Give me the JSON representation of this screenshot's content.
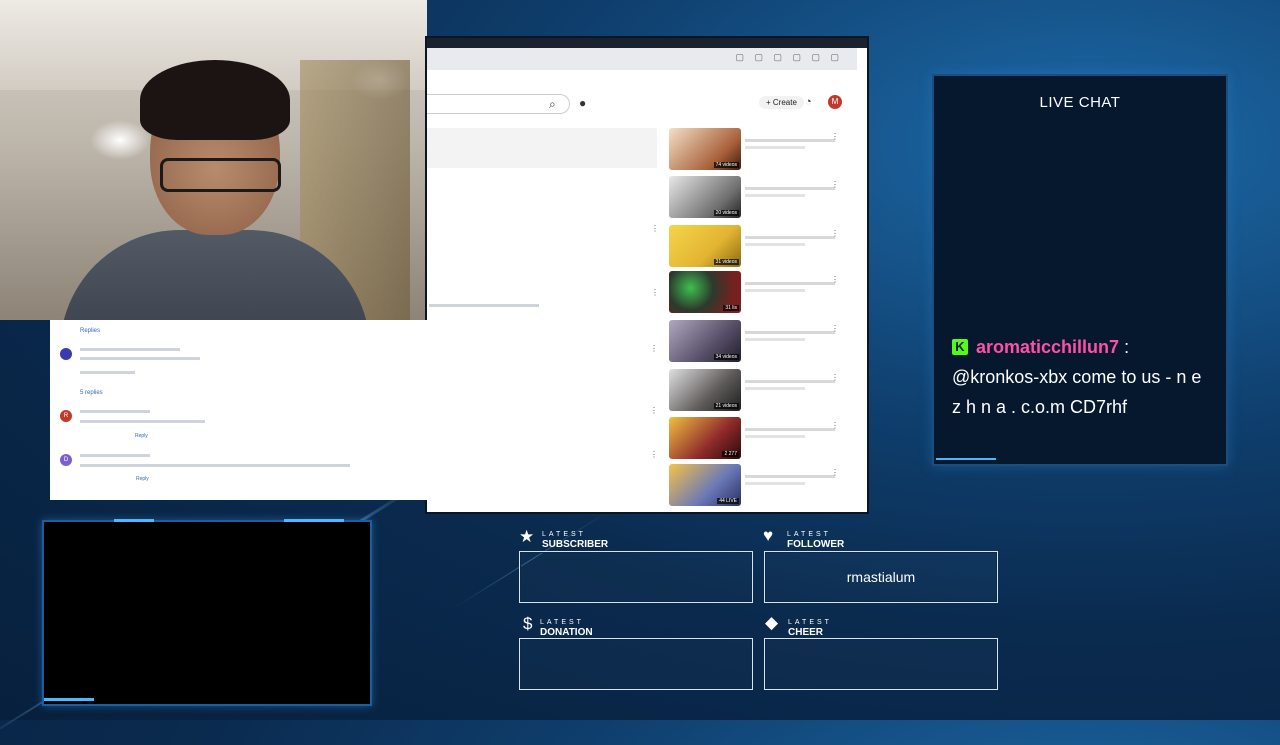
{
  "browser": {
    "create_label": "+ Create",
    "avatar_letter": "M",
    "playlists": [
      {
        "badge": "74 videos",
        "color": "#a8603a"
      },
      {
        "badge": "20 videos",
        "color": "#6f6f6f"
      },
      {
        "badge": "31 videos",
        "color": "#e2b431"
      },
      {
        "badge": "31 lis",
        "color": "#3b4a3a"
      },
      {
        "badge": "34 videos",
        "color": "#58506a"
      },
      {
        "badge": "21 videos",
        "color": "#5e5a5a"
      },
      {
        "badge": "2 277",
        "color": "#8e2a2a"
      },
      {
        "badge": "44 LIVE",
        "color": "#6a78b8"
      }
    ]
  },
  "comments": {
    "replies_1": "Replies",
    "replies_2": "5 replies",
    "avatars": [
      {
        "letter": "",
        "color": "#3b3bb0"
      },
      {
        "letter": "R",
        "color": "#c0392b"
      },
      {
        "letter": "D",
        "color": "#7b5fd1"
      }
    ],
    "reply_label": "Reply"
  },
  "chat": {
    "title": "LIVE CHAT",
    "username": "aromaticchillun7",
    "separator": ":",
    "message": "@kronkos-xbx come to us - n e z h n a . c.o.m CD7rhf",
    "platform_icon_letter": "K"
  },
  "widgets": {
    "subscriber": {
      "top": "LATEST",
      "bottom": "SUBSCRIBER",
      "value": ""
    },
    "follower": {
      "top": "LATEST",
      "bottom": "FOLLOWER",
      "value": "rmastialum"
    },
    "donation": {
      "top": "LATEST",
      "bottom": "DONATION",
      "value": ""
    },
    "cheer": {
      "top": "LATEST",
      "bottom": "CHEER",
      "value": ""
    }
  },
  "icons": {
    "star": "★",
    "heart": "♥",
    "dollar": "$",
    "diamond": "◆",
    "search": "⌕",
    "mic": "🎙",
    "bell": "🔔",
    "kebab": "⋮"
  },
  "colors": {
    "accent_blue": "#4fb7ff",
    "chat_username": "#ff4fa8",
    "kick_green": "#53fc18"
  }
}
